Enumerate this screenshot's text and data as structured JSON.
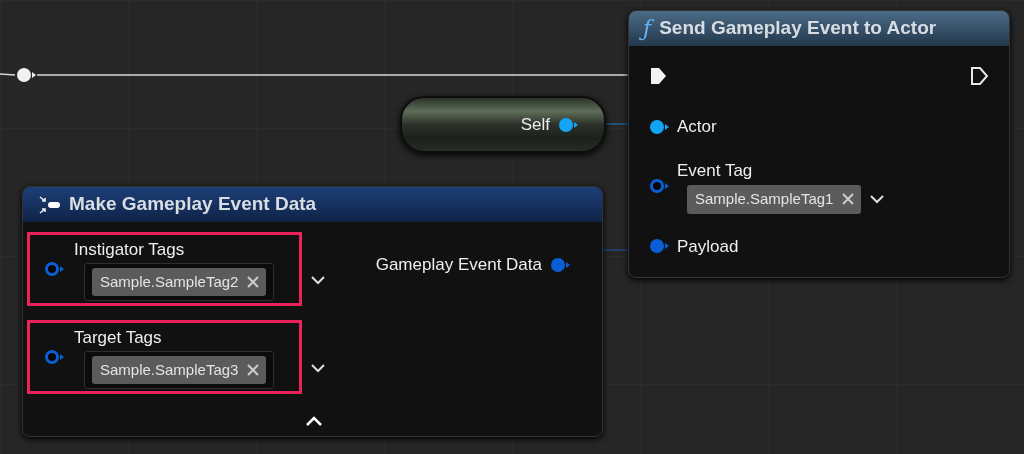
{
  "reroute_node": {
    "connected": true
  },
  "self_node": {
    "label": "Self",
    "pin": {
      "color": "#14a4f5",
      "connected": true
    }
  },
  "send_node": {
    "icon_glyph": "ƒ",
    "title": "Send Gameplay Event to Actor",
    "exec_in": {
      "connected": true
    },
    "exec_out": {
      "connected": false
    },
    "inputs": [
      {
        "label": "Actor",
        "color": "#14a4f5",
        "connected": true
      },
      {
        "label": "Event Tag",
        "color": "#0b5fd6",
        "connected": false,
        "tag": "Sample.SampleTag1"
      },
      {
        "label": "Payload",
        "color": "#0b5fd6",
        "connected": true
      }
    ]
  },
  "make_node": {
    "title": "Make Gameplay Event Data",
    "inputs": [
      {
        "label": "Instigator Tags",
        "color": "#0b5fd6",
        "connected": false,
        "tag": "Sample.SampleTag2",
        "highlighted": true
      },
      {
        "label": "Target Tags",
        "color": "#0b5fd6",
        "connected": false,
        "tag": "Sample.SampleTag3",
        "highlighted": true
      }
    ],
    "outputs": [
      {
        "label": "Gameplay Event Data",
        "color": "#0b5fd6",
        "connected": true
      }
    ]
  }
}
